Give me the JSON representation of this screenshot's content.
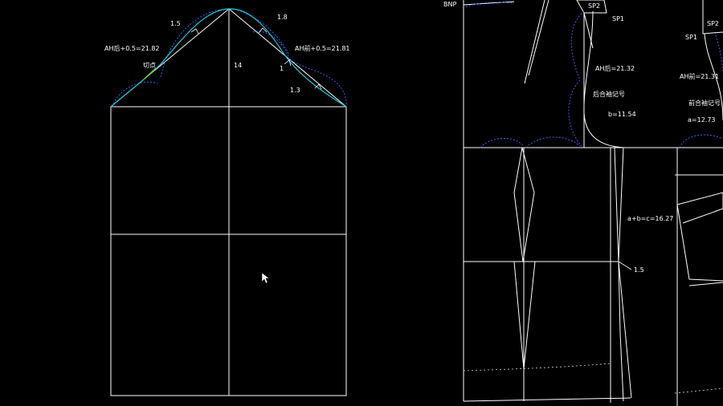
{
  "sleeve": {
    "labels": {
      "m15": "1.5",
      "m18": "1.8",
      "ah_back": "AH后+0.5=21.82",
      "ah_front": "AH前+0.5=21.81",
      "tangent": "切点",
      "cap_height": "14",
      "m1": "1",
      "m13": "1.3"
    }
  },
  "bodice": {
    "labels": {
      "bnp": "BNP",
      "sp2_left": "SP2",
      "sp1_left": "SP1",
      "sp2_right": "SP2",
      "sp1_right": "SP1",
      "ah_back": "AH后=21.32",
      "ah_front": "AH前=21.31",
      "back_notch": "后合袖记号",
      "front_notch": "前合袖记号",
      "b_val": "b=11.54",
      "a_val": "a=12.73",
      "abc": "a+b=c=16.27",
      "m15": "1.5"
    }
  },
  "colors": {
    "line": "#ffffff",
    "curve": "#19c7d8",
    "tangent_mark": "#7cd62a",
    "construction": "#2f63ff",
    "background": "#000000"
  },
  "cursor": "mouse-pointer-icon"
}
